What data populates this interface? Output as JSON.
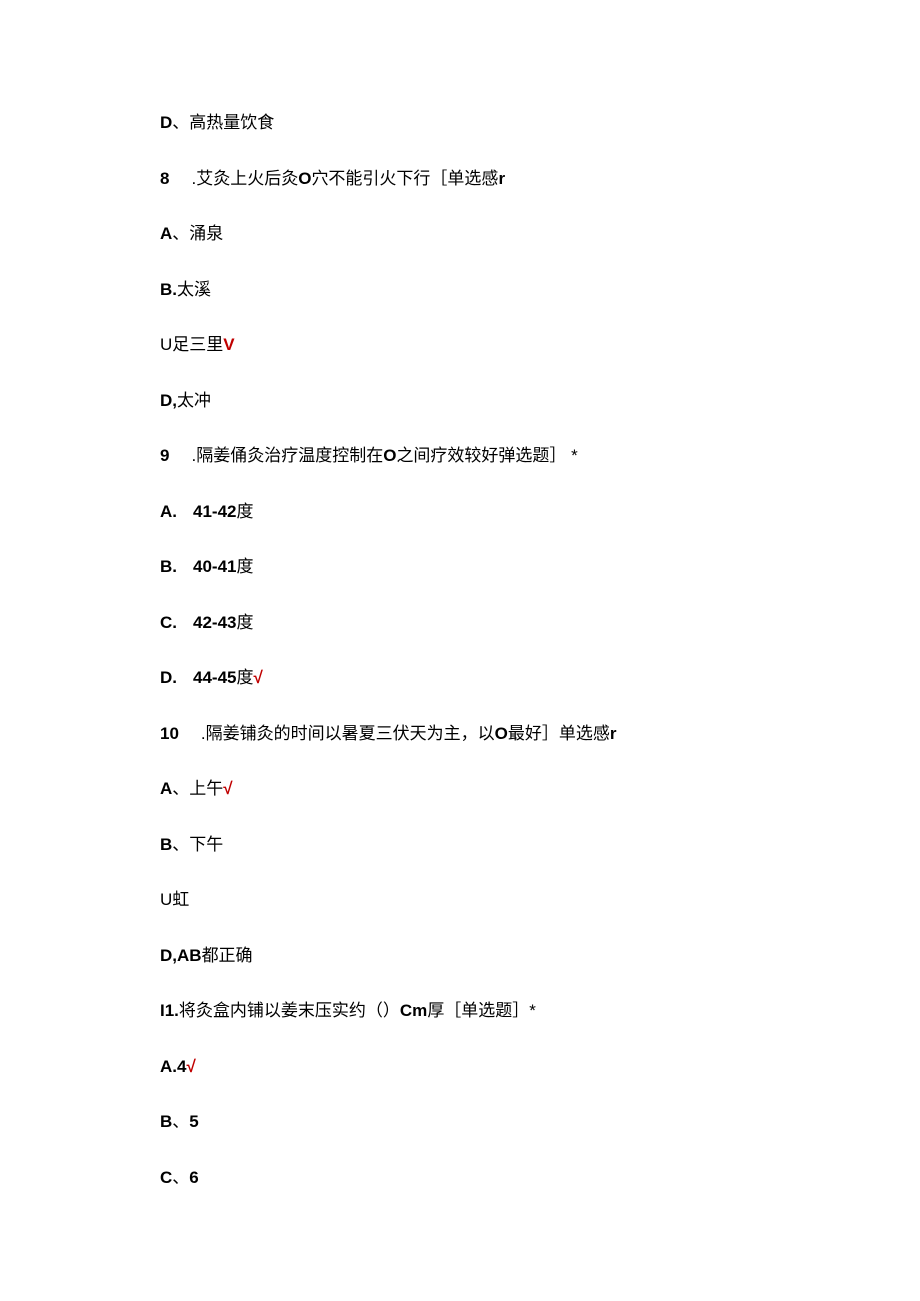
{
  "q7": {
    "optD": {
      "label": "D",
      "sep": "、",
      "text": "高热量饮食"
    }
  },
  "q8": {
    "num": "8",
    "stem_pre": ".艾灸上火后灸",
    "stem_mid": "O",
    "stem_post": "穴不能引火下行［单选感",
    "stem_end": "r",
    "optA": {
      "label": "A",
      "sep": "、",
      "text": "涌泉"
    },
    "optB": {
      "label": "B.",
      "text": "太溪"
    },
    "optC": {
      "pre": "U足三里",
      "mark": "V"
    },
    "optD": {
      "label": "D,",
      "text": "太冲"
    }
  },
  "q9": {
    "num": "9",
    "stem_pre": ".隔姜俑灸治疗温度控制在",
    "stem_mid": "O",
    "stem_post": "之间疗效较好弹选题］ *",
    "optA": {
      "label": "A.",
      "text": "41-42",
      "unit": "度"
    },
    "optB": {
      "label": "B.",
      "text": "40-41",
      "unit": "度"
    },
    "optC": {
      "label": "C.",
      "text": "42-43",
      "unit": "度"
    },
    "optD": {
      "label": "D.",
      "text": "44-45",
      "unit": "度",
      "mark": "√"
    }
  },
  "q10": {
    "num": "10",
    "stem_pre": ".隔姜铺灸的时间以暑夏三伏天为主，以",
    "stem_mid": "O",
    "stem_post": "最好］单选感",
    "stem_end": "r",
    "optA": {
      "label": "A",
      "sep": "、",
      "text": "上午",
      "mark": "√"
    },
    "optB": {
      "label": "B",
      "sep": "、",
      "text": "下午"
    },
    "optC": {
      "text": "U虹"
    },
    "optD": {
      "label": "D,AB",
      "text": "都正确"
    }
  },
  "q11": {
    "num": "I1.",
    "stem_pre": "将灸盒内铺以姜末压实约（）",
    "stem_mid": "Cm",
    "stem_post": "厚［单选题］*",
    "optA": {
      "label": "A.4",
      "mark": "√"
    },
    "optB": {
      "label": "B",
      "sep": "、",
      "text": "5"
    },
    "optC": {
      "label": "C",
      "sep": "、",
      "text": "6"
    }
  }
}
